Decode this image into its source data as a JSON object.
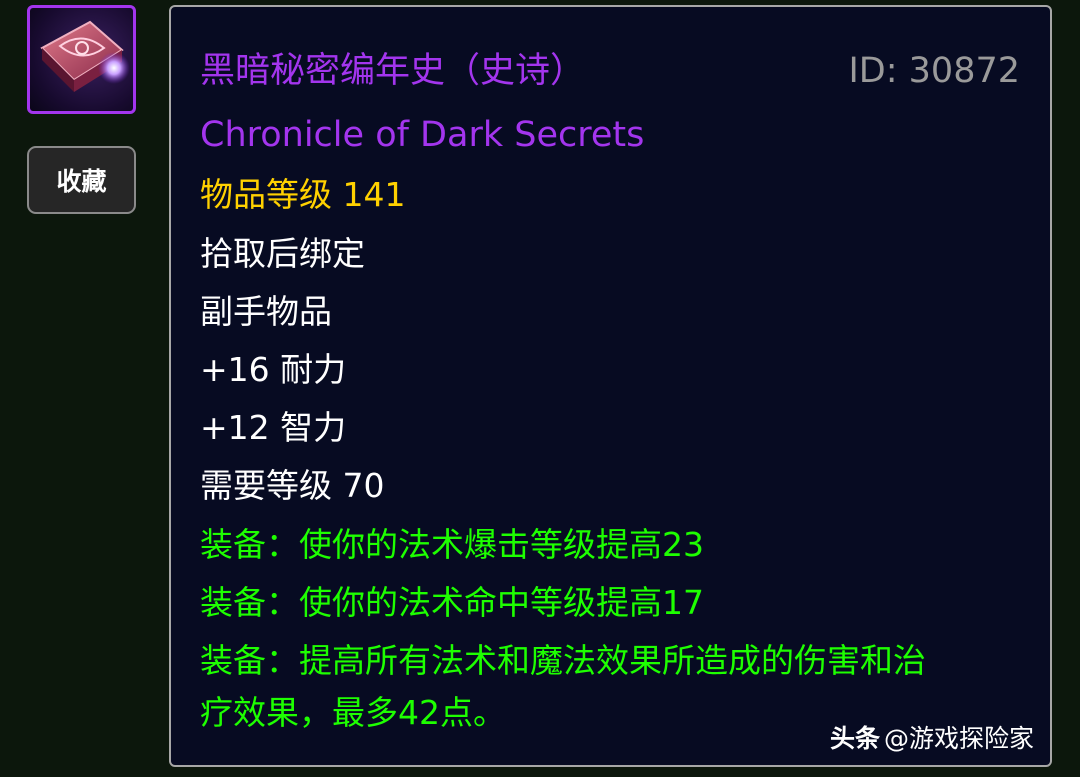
{
  "sidebar": {
    "item_icon": "purple-tome-icon",
    "favorite_label": "收藏"
  },
  "tooltip": {
    "name_cn": "黑暗秘密编年史（史诗）",
    "item_id": "ID: 30872",
    "name_en": "Chronicle of Dark Secrets",
    "item_level": "物品等级 141",
    "binding": "拾取后绑定",
    "slot": "副手物品",
    "stamina": "+16 耐力",
    "intellect": "+12 智力",
    "required_level": "需要等级 70",
    "equip_effects": [
      "装备：使你的法术爆击等级提高23",
      "装备：使你的法术命中等级提高17",
      "装备：提高所有法术和魔法效果所造成的伤害和治",
      "疗效果，最多42点。"
    ]
  },
  "watermark": {
    "brand": "头条",
    "author": "@游戏探险家"
  },
  "colors": {
    "epic": "#a335ee",
    "item_level": "#ffd100",
    "equip_effect": "#1eff00",
    "tooltip_bg": "#070b22",
    "page_bg": "#0c170c"
  }
}
